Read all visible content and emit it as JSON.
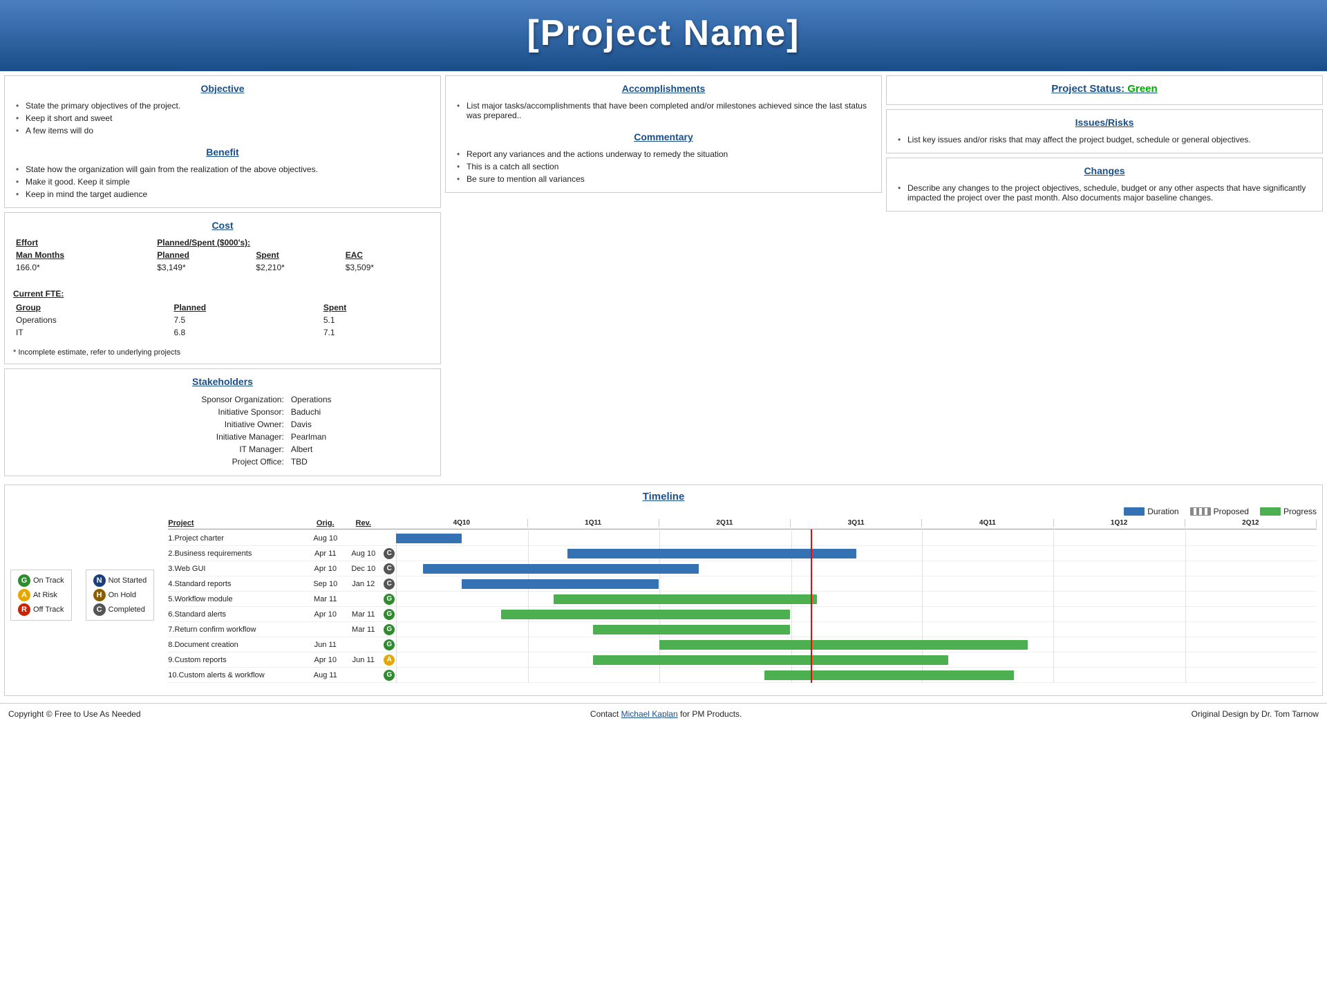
{
  "header": {
    "title": "[Project Name]"
  },
  "objective": {
    "title": "Objective",
    "items": [
      "State the primary objectives of the project.",
      "Keep it short and sweet",
      "A few items will do"
    ]
  },
  "benefit": {
    "title": "Benefit",
    "items": [
      "State how the organization will gain from the realization of the above objectives.",
      "Make it good. Keep it simple",
      "Keep in mind the target audience"
    ]
  },
  "accomplishments": {
    "title": "Accomplishments",
    "items": [
      "List major tasks/accomplishments that have been completed and/or milestones achieved since the last status was prepared.."
    ]
  },
  "commentary": {
    "title": "Commentary",
    "items": [
      "Report any variances and the actions underway to remedy the situation",
      "This is a catch all section",
      "Be sure to mention all variances"
    ]
  },
  "project_status": {
    "title": "Project Status:",
    "status": "Green"
  },
  "issues_risks": {
    "title": "Issues/Risks",
    "items": [
      "List key issues and/or risks that may affect the project budget, schedule or general objectives."
    ]
  },
  "changes": {
    "title": "Changes",
    "items": [
      "Describe any changes to the project objectives, schedule, budget or any other aspects that have significantly impacted the project over the past month. Also documents major baseline changes."
    ]
  },
  "cost": {
    "title": "Cost",
    "effort_label": "Effort",
    "planned_spent_label": "Planned/Spent ($000's):",
    "man_months_label": "Man Months",
    "planned_label": "Planned",
    "spent_label": "Spent",
    "eac_label": "EAC",
    "man_months_value": "166.0*",
    "planned_value": "$3,149*",
    "spent_value": "$2,210*",
    "eac_value": "$3,509*",
    "current_fte_label": "Current FTE:",
    "group_label": "Group",
    "fte_rows": [
      {
        "group": "Operations",
        "planned": "7.5",
        "spent": "5.1"
      },
      {
        "group": "IT",
        "planned": "6.8",
        "spent": "7.1"
      }
    ],
    "footnote": "* Incomplete estimate, refer to underlying projects"
  },
  "stakeholders": {
    "title": "Stakeholders",
    "rows": [
      {
        "label": "Sponsor Organization:",
        "value": "Operations"
      },
      {
        "label": "Initiative Sponsor:",
        "value": "Baduchi"
      },
      {
        "label": "Initiative Owner:",
        "value": "Davis"
      },
      {
        "label": "Initiative Manager:",
        "value": "Pearlman"
      },
      {
        "label": "IT Manager:",
        "value": "Albert"
      },
      {
        "label": "Project Office:",
        "value": "TBD"
      }
    ]
  },
  "timeline": {
    "title": "Timeline",
    "legend": [
      {
        "code": "G",
        "color": "lc-green",
        "label": "On Track"
      },
      {
        "code": "N",
        "color": "lc-navy",
        "label": "Not Started"
      },
      {
        "code": "A",
        "color": "lc-amber",
        "label": "At Risk"
      },
      {
        "code": "H",
        "color": "lc-hold",
        "label": "On Hold"
      },
      {
        "code": "R",
        "color": "lc-red",
        "label": "Off Track"
      },
      {
        "code": "C",
        "color": "lc-comp",
        "label": "Completed"
      }
    ],
    "col_project": "Project",
    "col_orig": "Orig.",
    "col_rev": "Rev.",
    "quarters": [
      "4Q10",
      "1Q11",
      "2Q11",
      "3Q11",
      "4Q11",
      "1Q12",
      "2Q12"
    ],
    "projects": [
      {
        "name": "1.Project charter",
        "orig": "Aug 10",
        "rev": "",
        "status": "",
        "bar_start": 0,
        "bar_end": 0.5,
        "bar_type": "blue"
      },
      {
        "name": "2.Business requirements",
        "orig": "Apr 11",
        "rev": "Aug 10",
        "status": "C",
        "bar_start": 1.5,
        "bar_end": 3.5,
        "bar_type": "blue"
      },
      {
        "name": "3.Web GUI",
        "orig": "Apr 10",
        "rev": "Dec 10",
        "status": "C",
        "bar_start": 0.5,
        "bar_end": 2.5,
        "bar_type": "blue"
      },
      {
        "name": "4.Standard reports",
        "orig": "Sep 10",
        "rev": "Jan 12",
        "status": "C",
        "bar_start": 0.8,
        "bar_end": 2.2,
        "bar_type": "blue"
      },
      {
        "name": "5.Workflow module",
        "orig": "Mar 11",
        "rev": "",
        "status": "G",
        "bar_start": 1.2,
        "bar_end": 3.2,
        "bar_type": "green"
      },
      {
        "name": "6.Standard alerts",
        "orig": "Apr 10",
        "rev": "Mar 11",
        "status": "G",
        "bar_start": 1.0,
        "bar_end": 3.0,
        "bar_type": "green"
      },
      {
        "name": "7.Return confirm workflow",
        "orig": "",
        "rev": "Mar 11",
        "status": "G",
        "bar_start": 1.5,
        "bar_end": 3.0,
        "bar_type": "green"
      },
      {
        "name": "8.Document creation",
        "orig": "Jun 11",
        "rev": "",
        "status": "G",
        "bar_start": 2.0,
        "bar_end": 4.5,
        "bar_type": "green"
      },
      {
        "name": "9.Custom reports",
        "orig": "Apr 10",
        "rev": "Jun 11",
        "status": "A",
        "bar_start": 1.5,
        "bar_end": 4.0,
        "bar_type": "green"
      },
      {
        "name": "10.Custom alerts & workflow",
        "orig": "Aug 11",
        "rev": "",
        "status": "G",
        "bar_start": 2.5,
        "bar_end": 4.5,
        "bar_type": "green"
      }
    ],
    "duration_legend": [
      {
        "label": "Duration",
        "color": "#3472b4",
        "type": "solid"
      },
      {
        "label": "Proposed",
        "color": "#888",
        "type": "dashed"
      },
      {
        "label": "Progress",
        "color": "#4caf50",
        "type": "solid"
      }
    ]
  },
  "footer": {
    "left": "Copyright © Free to Use As Needed",
    "middle_prefix": "Contact ",
    "middle_link_text": "Michael Kaplan",
    "middle_link_href": "#",
    "middle_suffix": " for PM Products.",
    "right": "Original Design by Dr. Tom Tarnow"
  }
}
